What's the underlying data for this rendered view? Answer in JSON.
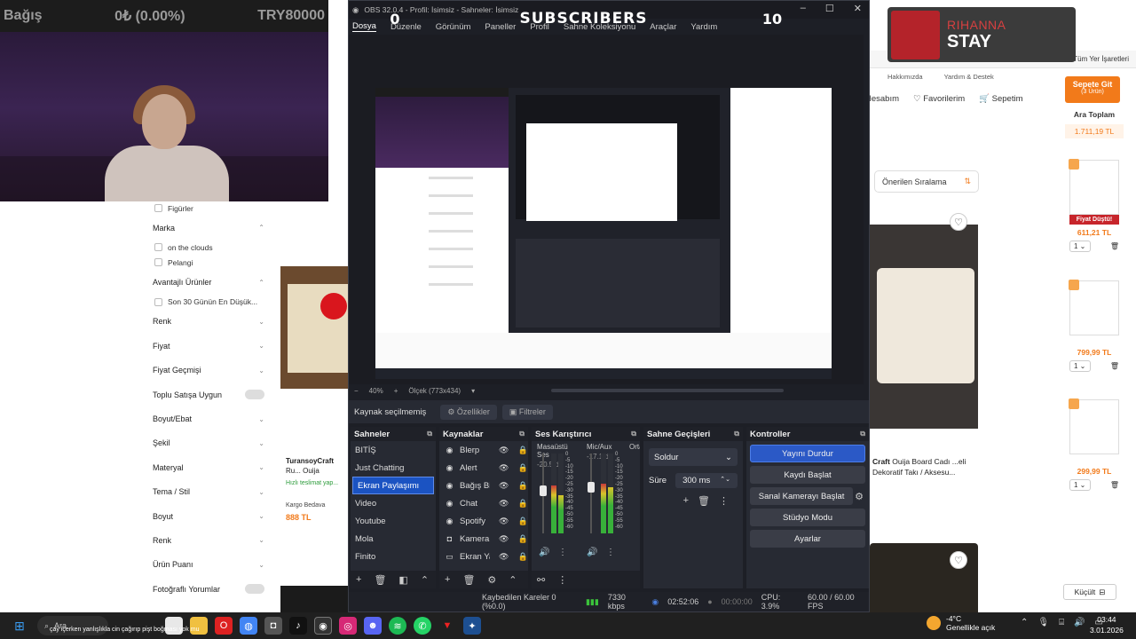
{
  "overlay": {
    "left_label": "Bağış",
    "amount": "0₺ (0.00%)",
    "goal": "TRY80000",
    "subs_left": "0",
    "subs_label": "SUBSCRIBERS",
    "subs_right": "10"
  },
  "browser": {
    "bookmarks_right": "Tüm Yer İşaretleri",
    "help_links": [
      "Hakkımızda",
      "Yardım & Destek"
    ],
    "nav": [
      "Hesabım",
      "Favorilerim",
      "Sepetim"
    ],
    "sort_label": "Önerilen Sıralama"
  },
  "music": {
    "artist": "RIHANNA",
    "song": "STAY"
  },
  "filters": [
    {
      "label": "Figürler",
      "type": "check"
    },
    {
      "label": "Marka",
      "type": "header",
      "chev": "⌃"
    },
    {
      "label": "on the clouds",
      "type": "check"
    },
    {
      "label": "Pelangi",
      "type": "check"
    },
    {
      "label": "Avantajlı Ürünler",
      "type": "header",
      "chev": "⌃"
    },
    {
      "label": "Son 30 Günün En Düşük...",
      "type": "check"
    },
    {
      "label": "Renk",
      "type": "header",
      "chev": "⌄"
    },
    {
      "label": "Fiyat",
      "type": "header",
      "chev": "⌄"
    },
    {
      "label": "Fiyat Geçmişi",
      "type": "header",
      "chev": "⌄"
    },
    {
      "label": "Toplu Satışa Uygun",
      "type": "toggle"
    },
    {
      "label": "Boyut/Ebat",
      "type": "header",
      "chev": "⌄"
    },
    {
      "label": "Şekil",
      "type": "header",
      "chev": "⌄"
    },
    {
      "label": "Materyal",
      "type": "header",
      "chev": "⌄"
    },
    {
      "label": "Tema / Stil",
      "type": "header",
      "chev": "⌄"
    },
    {
      "label": "Boyut",
      "type": "header",
      "chev": "⌄"
    },
    {
      "label": "Renk",
      "type": "header",
      "chev": "⌄"
    },
    {
      "label": "Ürün Puanı",
      "type": "header",
      "chev": "⌄"
    },
    {
      "label": "Fotoğraflı Yorumlar",
      "type": "toggle"
    }
  ],
  "product_left": {
    "brand": "TuransoyCraft",
    "title": "Ru... Ouija",
    "delivery": "Hızlı teslimat yap...",
    "cargo": "Kargo Bedava",
    "price": "888 TL"
  },
  "product_right": {
    "brand": "Craft",
    "title": "Ouija Board Cadı ...eli Dekoratif Takı / Aksesu..."
  },
  "basket": {
    "button": "Sepete Git",
    "count": "(3 Ürün)",
    "subtotal_label": "Ara Toplam",
    "subtotal": "1.711,19 TL",
    "items": [
      {
        "badge": "Fiyat Düştü!",
        "price": "611,21 TL",
        "qty": "1"
      },
      {
        "badge": "",
        "price": "799,99 TL",
        "qty": "1"
      },
      {
        "badge": "",
        "price": "299,99 TL",
        "qty": "1"
      }
    ],
    "shrink": "Küçült"
  },
  "obs": {
    "title": "OBS 32.0.4 - Profil: İsimsiz - Sahneler: İsimsiz",
    "menu": [
      "Dosya",
      "Düzenle",
      "Görünüm",
      "Paneller",
      "Profil",
      "Sahne Koleksiyonu",
      "Araçlar",
      "Yardım"
    ],
    "zoom": "40%",
    "scale": "Ölçek (773x434)",
    "source_status": "Kaynak seçilmemiş",
    "properties": "Özellikler",
    "filters": "Filtreler",
    "scenes_title": "Sahneler",
    "scenes": [
      "BITİŞ",
      "Just Chatting",
      "Ekran Paylaşımı",
      "Video",
      "Youtube",
      "Mola",
      "Finito"
    ],
    "active_scene": "Ekran Paylaşımı",
    "sources_title": "Kaynaklar",
    "sources": [
      "Blerp",
      "Alert",
      "Bağış Bil",
      "Chat",
      "Spotify",
      "Kamera",
      "Ekran Ya"
    ],
    "mixer_title": "Ses Karıştırıcı",
    "mixer": [
      {
        "name": "Masaüstü Ses",
        "db": "-20.5 dB"
      },
      {
        "name": "Mic/Aux",
        "db": "-17.1 dB"
      },
      {
        "name": "Orta",
        "db": ""
      }
    ],
    "mixer_scale": [
      "0",
      "-5",
      "-10",
      "-15",
      "-20",
      "-25",
      "-30",
      "-35",
      "-40",
      "-45",
      "-50",
      "-55",
      "-60"
    ],
    "transitions_title": "Sahne Geçişleri",
    "transition": "Soldur",
    "duration_label": "Süre",
    "duration": "300 ms",
    "controls_title": "Kontroller",
    "controls": [
      "Yayını Durdur",
      "Kaydı Başlat",
      "Sanal Kamerayı Başlat",
      "Stüdyo Modu",
      "Ayarlar"
    ],
    "status": {
      "dropped": "Kaybedilen Kareler 0 (%0.0)",
      "bitrate": "7330 kbps",
      "live": "02:52:06",
      "rec": "00:00:00",
      "cpu": "CPU: 3.9%",
      "fps": "60.00 / 60.00 FPS"
    }
  },
  "taskbar": {
    "search": "Ara",
    "ticker_red": "...",
    "ticker": "çay içerken yanlışlıkla cin çağırıp pişt boğması yok mu",
    "temp": "-4°C",
    "weather": "Genellikle açık",
    "time": "03:44",
    "date": "3.01.2026"
  }
}
